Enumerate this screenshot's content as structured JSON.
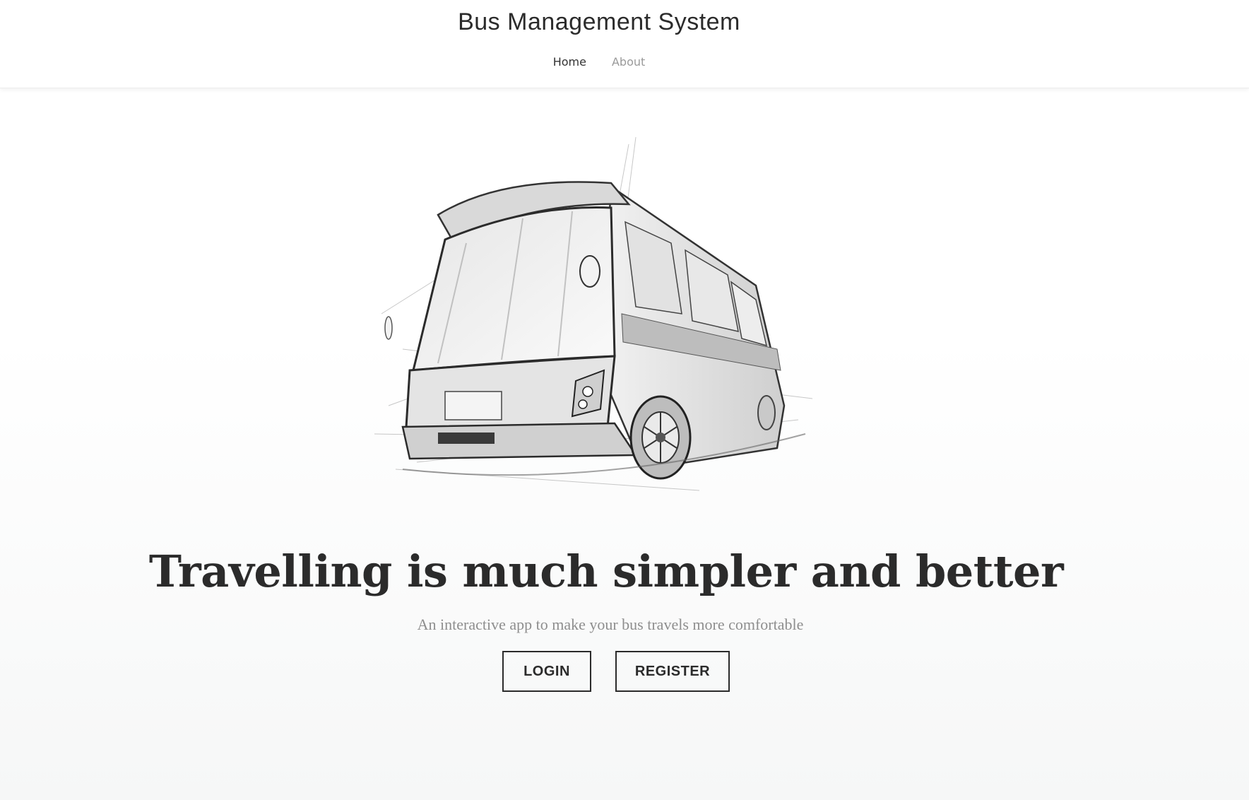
{
  "header": {
    "brand": "Bus Management System",
    "nav": [
      {
        "label": "Home",
        "active": true
      },
      {
        "label": "About",
        "active": false
      }
    ]
  },
  "hero": {
    "image_icon": "bus-sketch",
    "headline": "Travelling is much simpler and better",
    "subheadline": "An interactive app to make your bus travels more comfortable",
    "buttons": {
      "login": "LOGIN",
      "register": "REGISTER"
    }
  },
  "colors": {
    "text_dark": "#2b2b2b",
    "text_muted": "#8e8e8e",
    "nav_inactive": "#9a9a9a",
    "background": "#ffffff"
  }
}
